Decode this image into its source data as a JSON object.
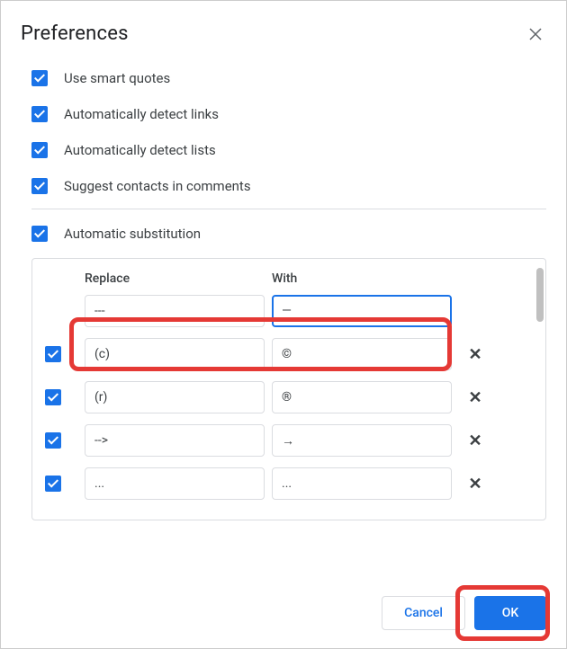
{
  "dialog": {
    "title": "Preferences",
    "options": {
      "smart_quotes": "Use smart quotes",
      "detect_links": "Automatically detect links",
      "detect_lists": "Automatically detect lists",
      "suggest_contacts": "Suggest contacts in comments",
      "auto_substitution": "Automatic substitution"
    },
    "table": {
      "header_replace": "Replace",
      "header_with": "With",
      "new_replace": "---",
      "new_with": "—",
      "rows": [
        {
          "replace": "(c)",
          "with": "©"
        },
        {
          "replace": "(r)",
          "with": "®"
        },
        {
          "replace": "-->",
          "with": "→"
        },
        {
          "replace": "...",
          "with": "..."
        }
      ]
    },
    "buttons": {
      "cancel": "Cancel",
      "ok": "OK"
    }
  }
}
